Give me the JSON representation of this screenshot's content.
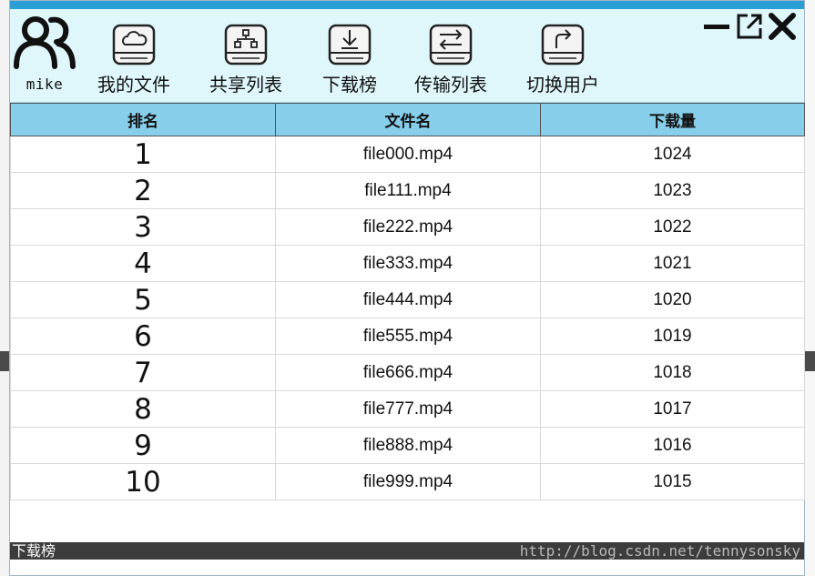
{
  "user": {
    "name": "mike"
  },
  "toolbar": {
    "items": [
      {
        "label": "我的文件",
        "icon": "cloud-drive-icon"
      },
      {
        "label": "共享列表",
        "icon": "share-drive-icon"
      },
      {
        "label": "下载榜",
        "icon": "download-drive-icon"
      },
      {
        "label": "传输列表",
        "icon": "transfer-drive-icon"
      },
      {
        "label": "切换用户",
        "icon": "switch-user-drive-icon"
      }
    ]
  },
  "window_controls": [
    "minimize-icon",
    "maximize-icon",
    "close-icon"
  ],
  "table": {
    "headers": [
      "排名",
      "文件名",
      "下载量"
    ],
    "rows": [
      [
        "1",
        "file000.mp4",
        "1024"
      ],
      [
        "2",
        "file111.mp4",
        "1023"
      ],
      [
        "3",
        "file222.mp4",
        "1022"
      ],
      [
        "4",
        "file333.mp4",
        "1021"
      ],
      [
        "5",
        "file444.mp4",
        "1020"
      ],
      [
        "6",
        "file555.mp4",
        "1019"
      ],
      [
        "7",
        "file666.mp4",
        "1018"
      ],
      [
        "8",
        "file777.mp4",
        "1017"
      ],
      [
        "9",
        "file888.mp4",
        "1016"
      ],
      [
        "10",
        "file999.mp4",
        "1015"
      ]
    ]
  },
  "status_bar": {
    "text": "下载榜"
  },
  "watermark": "http://blog.csdn.net/tennysonsky",
  "colors": {
    "accent": "#2a9fd6",
    "toolbar_bg": "#dff7fb",
    "header_bg": "#87ceeb",
    "status_bg": "#3c3c3c"
  }
}
